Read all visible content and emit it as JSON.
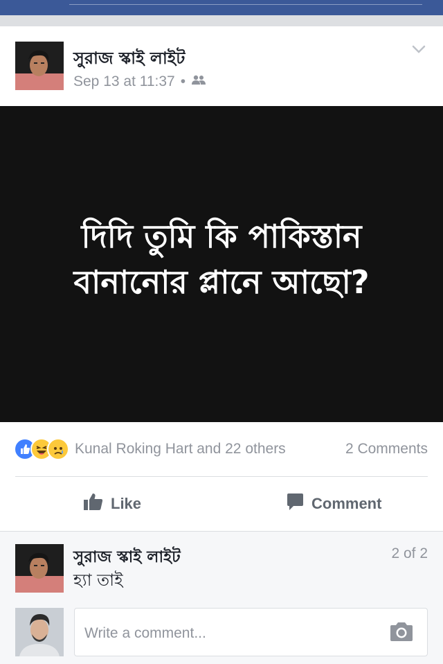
{
  "post": {
    "author": "সুরাজ স্কাই লাইট",
    "timestamp": "Sep 13 at 11:37",
    "separator": "•",
    "audience_icon": "friends-icon",
    "image_text_line1": "দিদি তুমি কি পাকিস্তান",
    "image_text_line2": "বানানোর প্লানে আছো?",
    "menu_icon": "chevron-down-icon"
  },
  "reactions": {
    "icons": [
      "like-reaction-icon",
      "haha-reaction-icon",
      "sad-reaction-icon"
    ],
    "summary": "Kunal Roking Hart and 22 others",
    "comments_count": "2 Comments"
  },
  "actions": {
    "like_label": "Like",
    "comment_label": "Comment"
  },
  "comment": {
    "author": "সুরাজ স্কাই লাইট",
    "text": "হ্যা তাই",
    "pager": "2 of 2"
  },
  "composer": {
    "placeholder": "Write a comment...",
    "camera_icon": "camera-icon"
  },
  "colors": {
    "brand": "#3b5998",
    "like_blue": "#4080ff",
    "reaction_yellow": "#fcc93b",
    "muted_text": "#90949c",
    "image_bg": "#121212"
  }
}
